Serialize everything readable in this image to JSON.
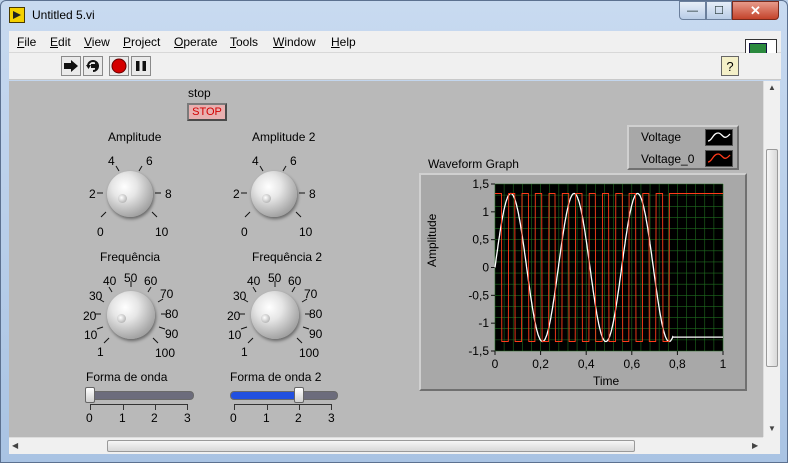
{
  "window": {
    "title": "Untitled 5.vi",
    "controls": {
      "minimize": "—",
      "maximize": "☐",
      "close": "✕"
    }
  },
  "menu": {
    "items": [
      {
        "label": "File",
        "key": "F",
        "rest": "ile"
      },
      {
        "label": "Edit",
        "key": "E",
        "rest": "dit"
      },
      {
        "label": "View",
        "key": "V",
        "rest": "iew"
      },
      {
        "label": "Project",
        "key": "P",
        "rest": "roject"
      },
      {
        "label": "Operate",
        "key": "O",
        "rest": "perate"
      },
      {
        "label": "Tools",
        "key": "T",
        "rest": "ools"
      },
      {
        "label": "Window",
        "key": "W",
        "rest": "indow"
      },
      {
        "label": "Help",
        "key": "H",
        "rest": "elp"
      }
    ]
  },
  "toolbar": {
    "run_icon": "run-arrow-icon",
    "run_continuous_icon": "run-continuously-icon",
    "abort_icon": "abort-icon",
    "pause_icon": "pause-icon",
    "help_label": "?"
  },
  "vi_icon": {
    "number": "5"
  },
  "panel": {
    "stop": {
      "label": "stop",
      "button_text": "STOP"
    },
    "knobs": [
      {
        "label": "Amplitude",
        "ticks": [
          "0",
          "2",
          "4",
          "6",
          "8",
          "10"
        ]
      },
      {
        "label": "Amplitude 2",
        "ticks": [
          "0",
          "2",
          "4",
          "6",
          "8",
          "10"
        ]
      },
      {
        "label": "Frequência",
        "ticks": [
          "1",
          "10",
          "20",
          "30",
          "40",
          "50",
          "60",
          "70",
          "80",
          "90",
          "100"
        ]
      },
      {
        "label": "Frequência 2",
        "ticks": [
          "1",
          "10",
          "20",
          "30",
          "40",
          "50",
          "60",
          "70",
          "80",
          "90",
          "100"
        ]
      }
    ],
    "sliders": [
      {
        "label": "Forma de onda",
        "value": 0,
        "max": 3,
        "ticks": [
          "0",
          "1",
          "2",
          "3"
        ]
      },
      {
        "label": "Forma de onda 2",
        "value": 2,
        "max": 3,
        "ticks": [
          "0",
          "1",
          "2",
          "3"
        ]
      }
    ]
  },
  "graph": {
    "title": "Waveform Graph",
    "xlabel": "Time",
    "ylabel": "Amplitude",
    "x_ticks": [
      "0",
      "0,2",
      "0,4",
      "0,6",
      "0,8",
      "1"
    ],
    "y_ticks": [
      "1,5",
      "1",
      "0,5",
      "0",
      "-0,5",
      "-1",
      "-1,5"
    ],
    "legend": [
      {
        "name": "Voltage",
        "color": "#ffffff"
      },
      {
        "name": "Voltage_0",
        "color": "#ff3a1a"
      }
    ],
    "grid_color": "#1f6b1f",
    "background": "#000000"
  },
  "chart_data": {
    "type": "line",
    "title": "Waveform Graph",
    "xlabel": "Time",
    "ylabel": "Amplitude",
    "xlim": [
      0,
      1
    ],
    "ylim": [
      -1.5,
      1.5
    ],
    "grid": true,
    "legend_position": "top-right",
    "series": [
      {
        "name": "Voltage",
        "color": "#ffffff",
        "kind": "sine",
        "amplitude": 1.33,
        "frequency_hz": 3.6,
        "x_end": 0.78,
        "tail_value": -1.25
      },
      {
        "name": "Voltage_0",
        "color": "#ff3a1a",
        "kind": "square",
        "amplitude": 1.33,
        "frequency_hz": 17,
        "x_end": 0.78,
        "tail_value": 1.33
      }
    ]
  }
}
